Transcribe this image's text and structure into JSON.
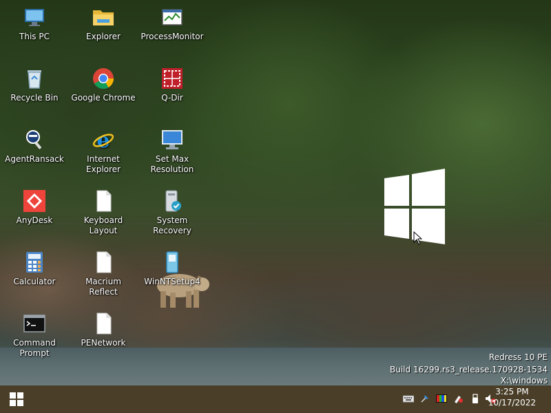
{
  "desktop": {
    "icons": [
      {
        "label": "This PC",
        "icon": "this-pc-icon"
      },
      {
        "label": "Explorer",
        "icon": "folder-icon"
      },
      {
        "label": "ProcessMonitor",
        "icon": "process-monitor-icon"
      },
      {
        "label": "Recycle Bin",
        "icon": "recycle-bin-icon"
      },
      {
        "label": "Google Chrome",
        "icon": "chrome-icon"
      },
      {
        "label": "Q-Dir",
        "icon": "qdir-icon"
      },
      {
        "label": "AgentRansack",
        "icon": "agent-ransack-icon"
      },
      {
        "label": "Internet Explorer",
        "icon": "ie-icon"
      },
      {
        "label": "Set Max Resolution",
        "icon": "monitor-icon"
      },
      {
        "label": "AnyDesk",
        "icon": "anydesk-icon"
      },
      {
        "label": "Keyboard Layout",
        "icon": "file-icon"
      },
      {
        "label": "System Recovery",
        "icon": "system-recovery-icon"
      },
      {
        "label": "Calculator",
        "icon": "calculator-icon"
      },
      {
        "label": "Macrium Reflect",
        "icon": "file-icon"
      },
      {
        "label": "WinNTSetup4",
        "icon": "winntsetup-icon"
      },
      {
        "label": "Command Prompt",
        "icon": "cmd-icon"
      },
      {
        "label": "PENetwork",
        "icon": "file-icon"
      }
    ],
    "watermark": {
      "line1": "Redress 10 PE",
      "line2": "Build 16299.rs3_release.170928-1534",
      "line3": "X:\\windows"
    }
  },
  "taskbar": {
    "start_icon": "windows-start-icon",
    "tray": [
      "keyboard-icon",
      "pin-icon",
      "color-icon",
      "paint-icon",
      "usb-icon",
      "volume-muted-icon"
    ],
    "clock": {
      "time": "3:25 PM",
      "date": "10/17/2022"
    }
  },
  "colors": {
    "taskbar": "#4a3e28",
    "text": "#ffffff"
  }
}
